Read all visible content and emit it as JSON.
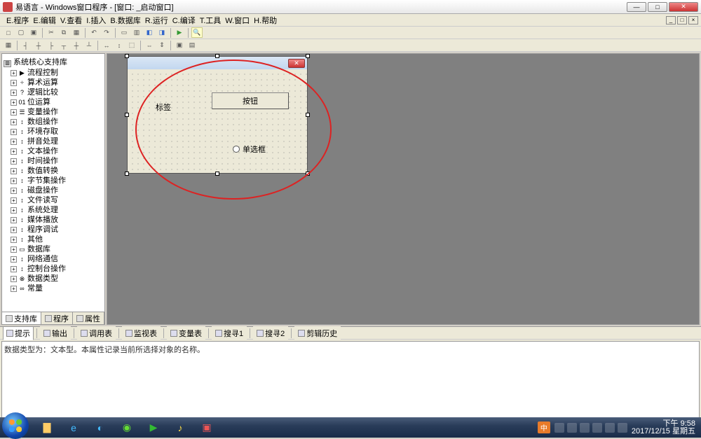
{
  "window": {
    "title": "易语言 - Windows窗口程序 - [窗口: _启动窗口]",
    "min": "—",
    "max": "□",
    "close": "✕"
  },
  "menu": {
    "items": [
      "E.程序",
      "E.编辑",
      "V.查看",
      "I.插入",
      "B.数据库",
      "R.运行",
      "C.编译",
      "T.工具",
      "W.窗口",
      "H.帮助"
    ]
  },
  "mdi_ctrls": [
    "_",
    "□",
    "×"
  ],
  "tree": {
    "root": "系统核心支持库",
    "items": [
      {
        "icon": "▶",
        "label": "流程控制"
      },
      {
        "icon": "÷",
        "label": "算术运算"
      },
      {
        "icon": "?",
        "label": "逻辑比较"
      },
      {
        "icon": "01",
        "label": "位运算"
      },
      {
        "icon": "☰",
        "label": "变量操作"
      },
      {
        "icon": "↕",
        "label": "数组操作"
      },
      {
        "icon": "↕",
        "label": "环境存取"
      },
      {
        "icon": "↕",
        "label": "拼音处理"
      },
      {
        "icon": "↕",
        "label": "文本操作"
      },
      {
        "icon": "↕",
        "label": "时间操作"
      },
      {
        "icon": "↕",
        "label": "数值转换"
      },
      {
        "icon": "↕",
        "label": "字节集操作"
      },
      {
        "icon": "↕",
        "label": "磁盘操作"
      },
      {
        "icon": "↕",
        "label": "文件读写"
      },
      {
        "icon": "↕",
        "label": "系统处理"
      },
      {
        "icon": "↕",
        "label": "媒体播放"
      },
      {
        "icon": "↕",
        "label": "程序调试"
      },
      {
        "icon": "↕",
        "label": "其他"
      },
      {
        "icon": "▭",
        "label": "数据库"
      },
      {
        "icon": "↕",
        "label": "网络通信"
      },
      {
        "icon": "↕",
        "label": "控制台操作"
      },
      {
        "icon": "⊗",
        "label": "数据类型"
      },
      {
        "icon": "∞",
        "label": "常量"
      }
    ]
  },
  "sidebar_tabs": [
    "支持库",
    "程序",
    "属性"
  ],
  "form": {
    "label_text": "标签",
    "button_text": "按钮",
    "radio_text": "单选框",
    "close": "✕"
  },
  "bottom": {
    "tabs": [
      "提示",
      "输出",
      "调用表",
      "监视表",
      "变量表",
      "搜寻1",
      "搜寻2",
      "剪辑历史"
    ],
    "content": "数据类型为：文本型。本属性记录当前所选择对象的名称。"
  },
  "taskbar": {
    "lang": "中",
    "time": "下午 9:58",
    "date": "2017/12/15 星期五"
  }
}
